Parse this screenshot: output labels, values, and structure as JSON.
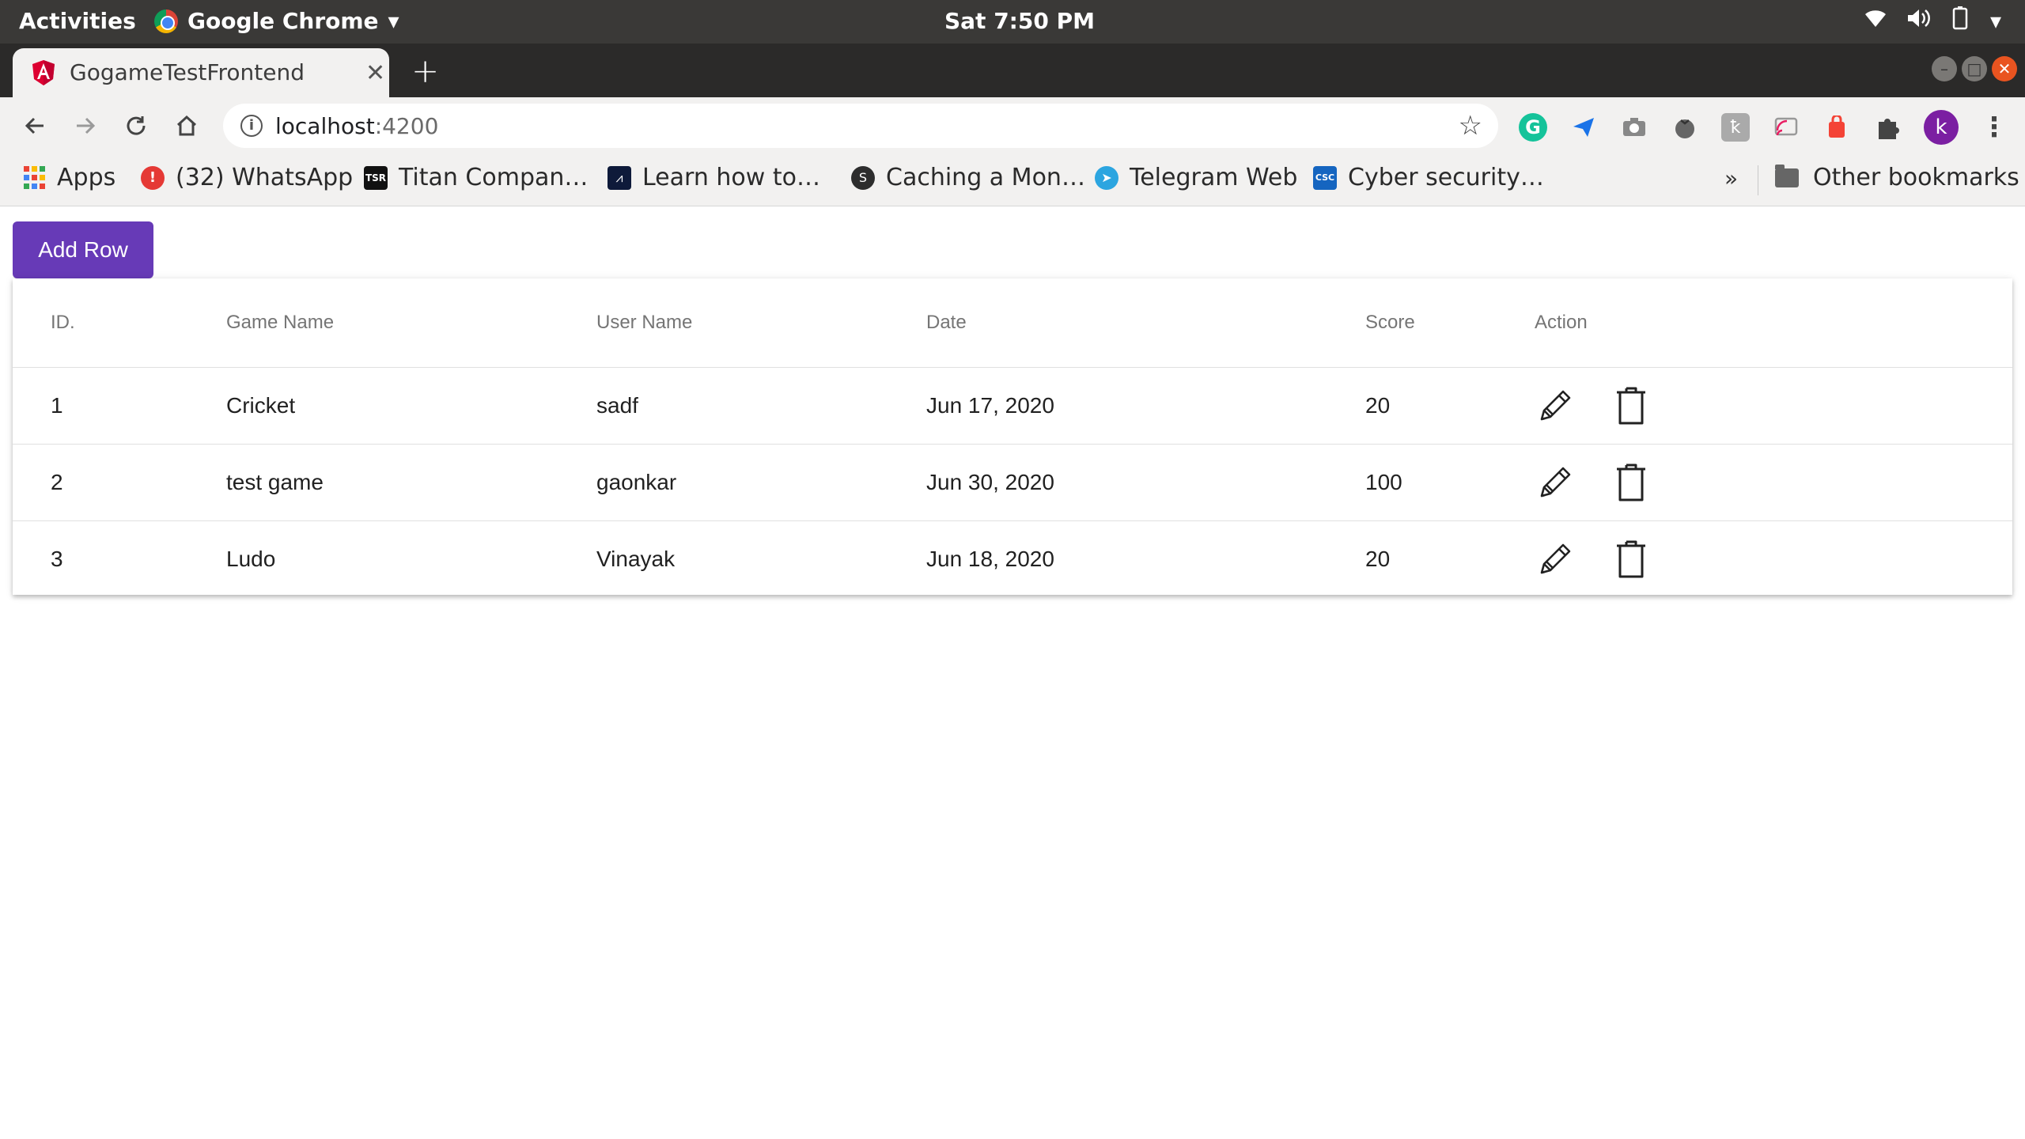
{
  "os_bar": {
    "activities": "Activities",
    "app_name": "Google Chrome",
    "clock": "Sat  7:50 PM"
  },
  "browser": {
    "tab_title": "GogameTestFrontend",
    "url_host": "localhost",
    "url_port": ":4200",
    "avatar_letter": "k",
    "bookmarks": [
      {
        "label": "Apps"
      },
      {
        "label": "(32) WhatsApp"
      },
      {
        "label": "Titan Compan…"
      },
      {
        "label": "Learn how to…"
      },
      {
        "label": "Caching a Mon…"
      },
      {
        "label": "Telegram Web"
      },
      {
        "label": "Cyber security…"
      }
    ],
    "more_bookmarks": "»",
    "other_bookmarks": "Other bookmarks"
  },
  "page": {
    "add_row_label": "Add Row",
    "primary_color": "#673ab7",
    "columns": [
      "ID.",
      "Game Name",
      "User Name",
      "Date",
      "Score",
      "Action"
    ],
    "rows": [
      {
        "id": "1",
        "game": "Cricket",
        "user": "sadf",
        "date": "Jun 17, 2020",
        "score": "20"
      },
      {
        "id": "2",
        "game": "test game",
        "user": "gaonkar",
        "date": "Jun 30, 2020",
        "score": "100"
      },
      {
        "id": "3",
        "game": "Ludo",
        "user": "Vinayak",
        "date": "Jun 18, 2020",
        "score": "20"
      }
    ],
    "row_actions": [
      "pencil-icon",
      "trash-icon"
    ]
  }
}
